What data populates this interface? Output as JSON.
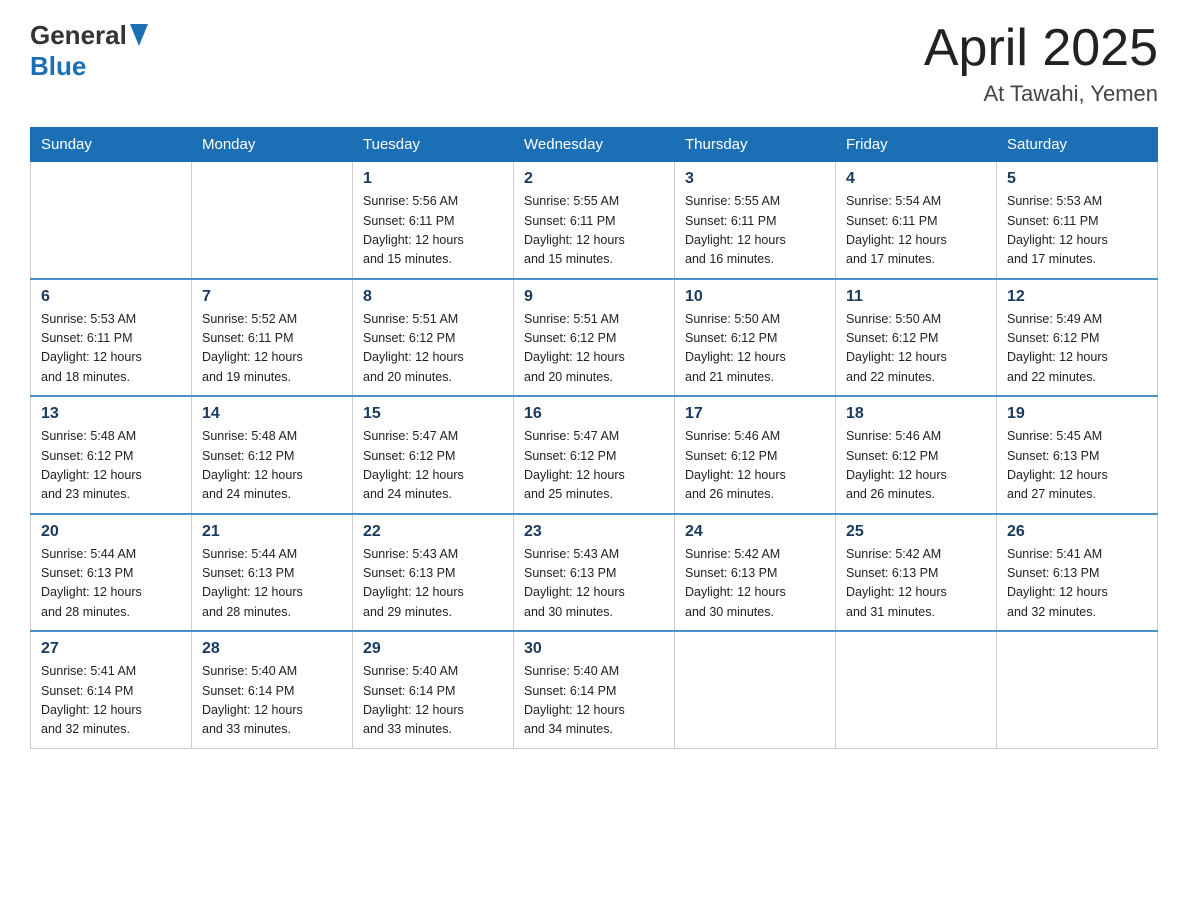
{
  "header": {
    "logo_general": "General",
    "logo_blue": "Blue",
    "title": "April 2025",
    "subtitle": "At Tawahi, Yemen"
  },
  "days_of_week": [
    "Sunday",
    "Monday",
    "Tuesday",
    "Wednesday",
    "Thursday",
    "Friday",
    "Saturday"
  ],
  "weeks": [
    [
      {
        "day": "",
        "info": ""
      },
      {
        "day": "",
        "info": ""
      },
      {
        "day": "1",
        "info": "Sunrise: 5:56 AM\nSunset: 6:11 PM\nDaylight: 12 hours\nand 15 minutes."
      },
      {
        "day": "2",
        "info": "Sunrise: 5:55 AM\nSunset: 6:11 PM\nDaylight: 12 hours\nand 15 minutes."
      },
      {
        "day": "3",
        "info": "Sunrise: 5:55 AM\nSunset: 6:11 PM\nDaylight: 12 hours\nand 16 minutes."
      },
      {
        "day": "4",
        "info": "Sunrise: 5:54 AM\nSunset: 6:11 PM\nDaylight: 12 hours\nand 17 minutes."
      },
      {
        "day": "5",
        "info": "Sunrise: 5:53 AM\nSunset: 6:11 PM\nDaylight: 12 hours\nand 17 minutes."
      }
    ],
    [
      {
        "day": "6",
        "info": "Sunrise: 5:53 AM\nSunset: 6:11 PM\nDaylight: 12 hours\nand 18 minutes."
      },
      {
        "day": "7",
        "info": "Sunrise: 5:52 AM\nSunset: 6:11 PM\nDaylight: 12 hours\nand 19 minutes."
      },
      {
        "day": "8",
        "info": "Sunrise: 5:51 AM\nSunset: 6:12 PM\nDaylight: 12 hours\nand 20 minutes."
      },
      {
        "day": "9",
        "info": "Sunrise: 5:51 AM\nSunset: 6:12 PM\nDaylight: 12 hours\nand 20 minutes."
      },
      {
        "day": "10",
        "info": "Sunrise: 5:50 AM\nSunset: 6:12 PM\nDaylight: 12 hours\nand 21 minutes."
      },
      {
        "day": "11",
        "info": "Sunrise: 5:50 AM\nSunset: 6:12 PM\nDaylight: 12 hours\nand 22 minutes."
      },
      {
        "day": "12",
        "info": "Sunrise: 5:49 AM\nSunset: 6:12 PM\nDaylight: 12 hours\nand 22 minutes."
      }
    ],
    [
      {
        "day": "13",
        "info": "Sunrise: 5:48 AM\nSunset: 6:12 PM\nDaylight: 12 hours\nand 23 minutes."
      },
      {
        "day": "14",
        "info": "Sunrise: 5:48 AM\nSunset: 6:12 PM\nDaylight: 12 hours\nand 24 minutes."
      },
      {
        "day": "15",
        "info": "Sunrise: 5:47 AM\nSunset: 6:12 PM\nDaylight: 12 hours\nand 24 minutes."
      },
      {
        "day": "16",
        "info": "Sunrise: 5:47 AM\nSunset: 6:12 PM\nDaylight: 12 hours\nand 25 minutes."
      },
      {
        "day": "17",
        "info": "Sunrise: 5:46 AM\nSunset: 6:12 PM\nDaylight: 12 hours\nand 26 minutes."
      },
      {
        "day": "18",
        "info": "Sunrise: 5:46 AM\nSunset: 6:12 PM\nDaylight: 12 hours\nand 26 minutes."
      },
      {
        "day": "19",
        "info": "Sunrise: 5:45 AM\nSunset: 6:13 PM\nDaylight: 12 hours\nand 27 minutes."
      }
    ],
    [
      {
        "day": "20",
        "info": "Sunrise: 5:44 AM\nSunset: 6:13 PM\nDaylight: 12 hours\nand 28 minutes."
      },
      {
        "day": "21",
        "info": "Sunrise: 5:44 AM\nSunset: 6:13 PM\nDaylight: 12 hours\nand 28 minutes."
      },
      {
        "day": "22",
        "info": "Sunrise: 5:43 AM\nSunset: 6:13 PM\nDaylight: 12 hours\nand 29 minutes."
      },
      {
        "day": "23",
        "info": "Sunrise: 5:43 AM\nSunset: 6:13 PM\nDaylight: 12 hours\nand 30 minutes."
      },
      {
        "day": "24",
        "info": "Sunrise: 5:42 AM\nSunset: 6:13 PM\nDaylight: 12 hours\nand 30 minutes."
      },
      {
        "day": "25",
        "info": "Sunrise: 5:42 AM\nSunset: 6:13 PM\nDaylight: 12 hours\nand 31 minutes."
      },
      {
        "day": "26",
        "info": "Sunrise: 5:41 AM\nSunset: 6:13 PM\nDaylight: 12 hours\nand 32 minutes."
      }
    ],
    [
      {
        "day": "27",
        "info": "Sunrise: 5:41 AM\nSunset: 6:14 PM\nDaylight: 12 hours\nand 32 minutes."
      },
      {
        "day": "28",
        "info": "Sunrise: 5:40 AM\nSunset: 6:14 PM\nDaylight: 12 hours\nand 33 minutes."
      },
      {
        "day": "29",
        "info": "Sunrise: 5:40 AM\nSunset: 6:14 PM\nDaylight: 12 hours\nand 33 minutes."
      },
      {
        "day": "30",
        "info": "Sunrise: 5:40 AM\nSunset: 6:14 PM\nDaylight: 12 hours\nand 34 minutes."
      },
      {
        "day": "",
        "info": ""
      },
      {
        "day": "",
        "info": ""
      },
      {
        "day": "",
        "info": ""
      }
    ]
  ]
}
